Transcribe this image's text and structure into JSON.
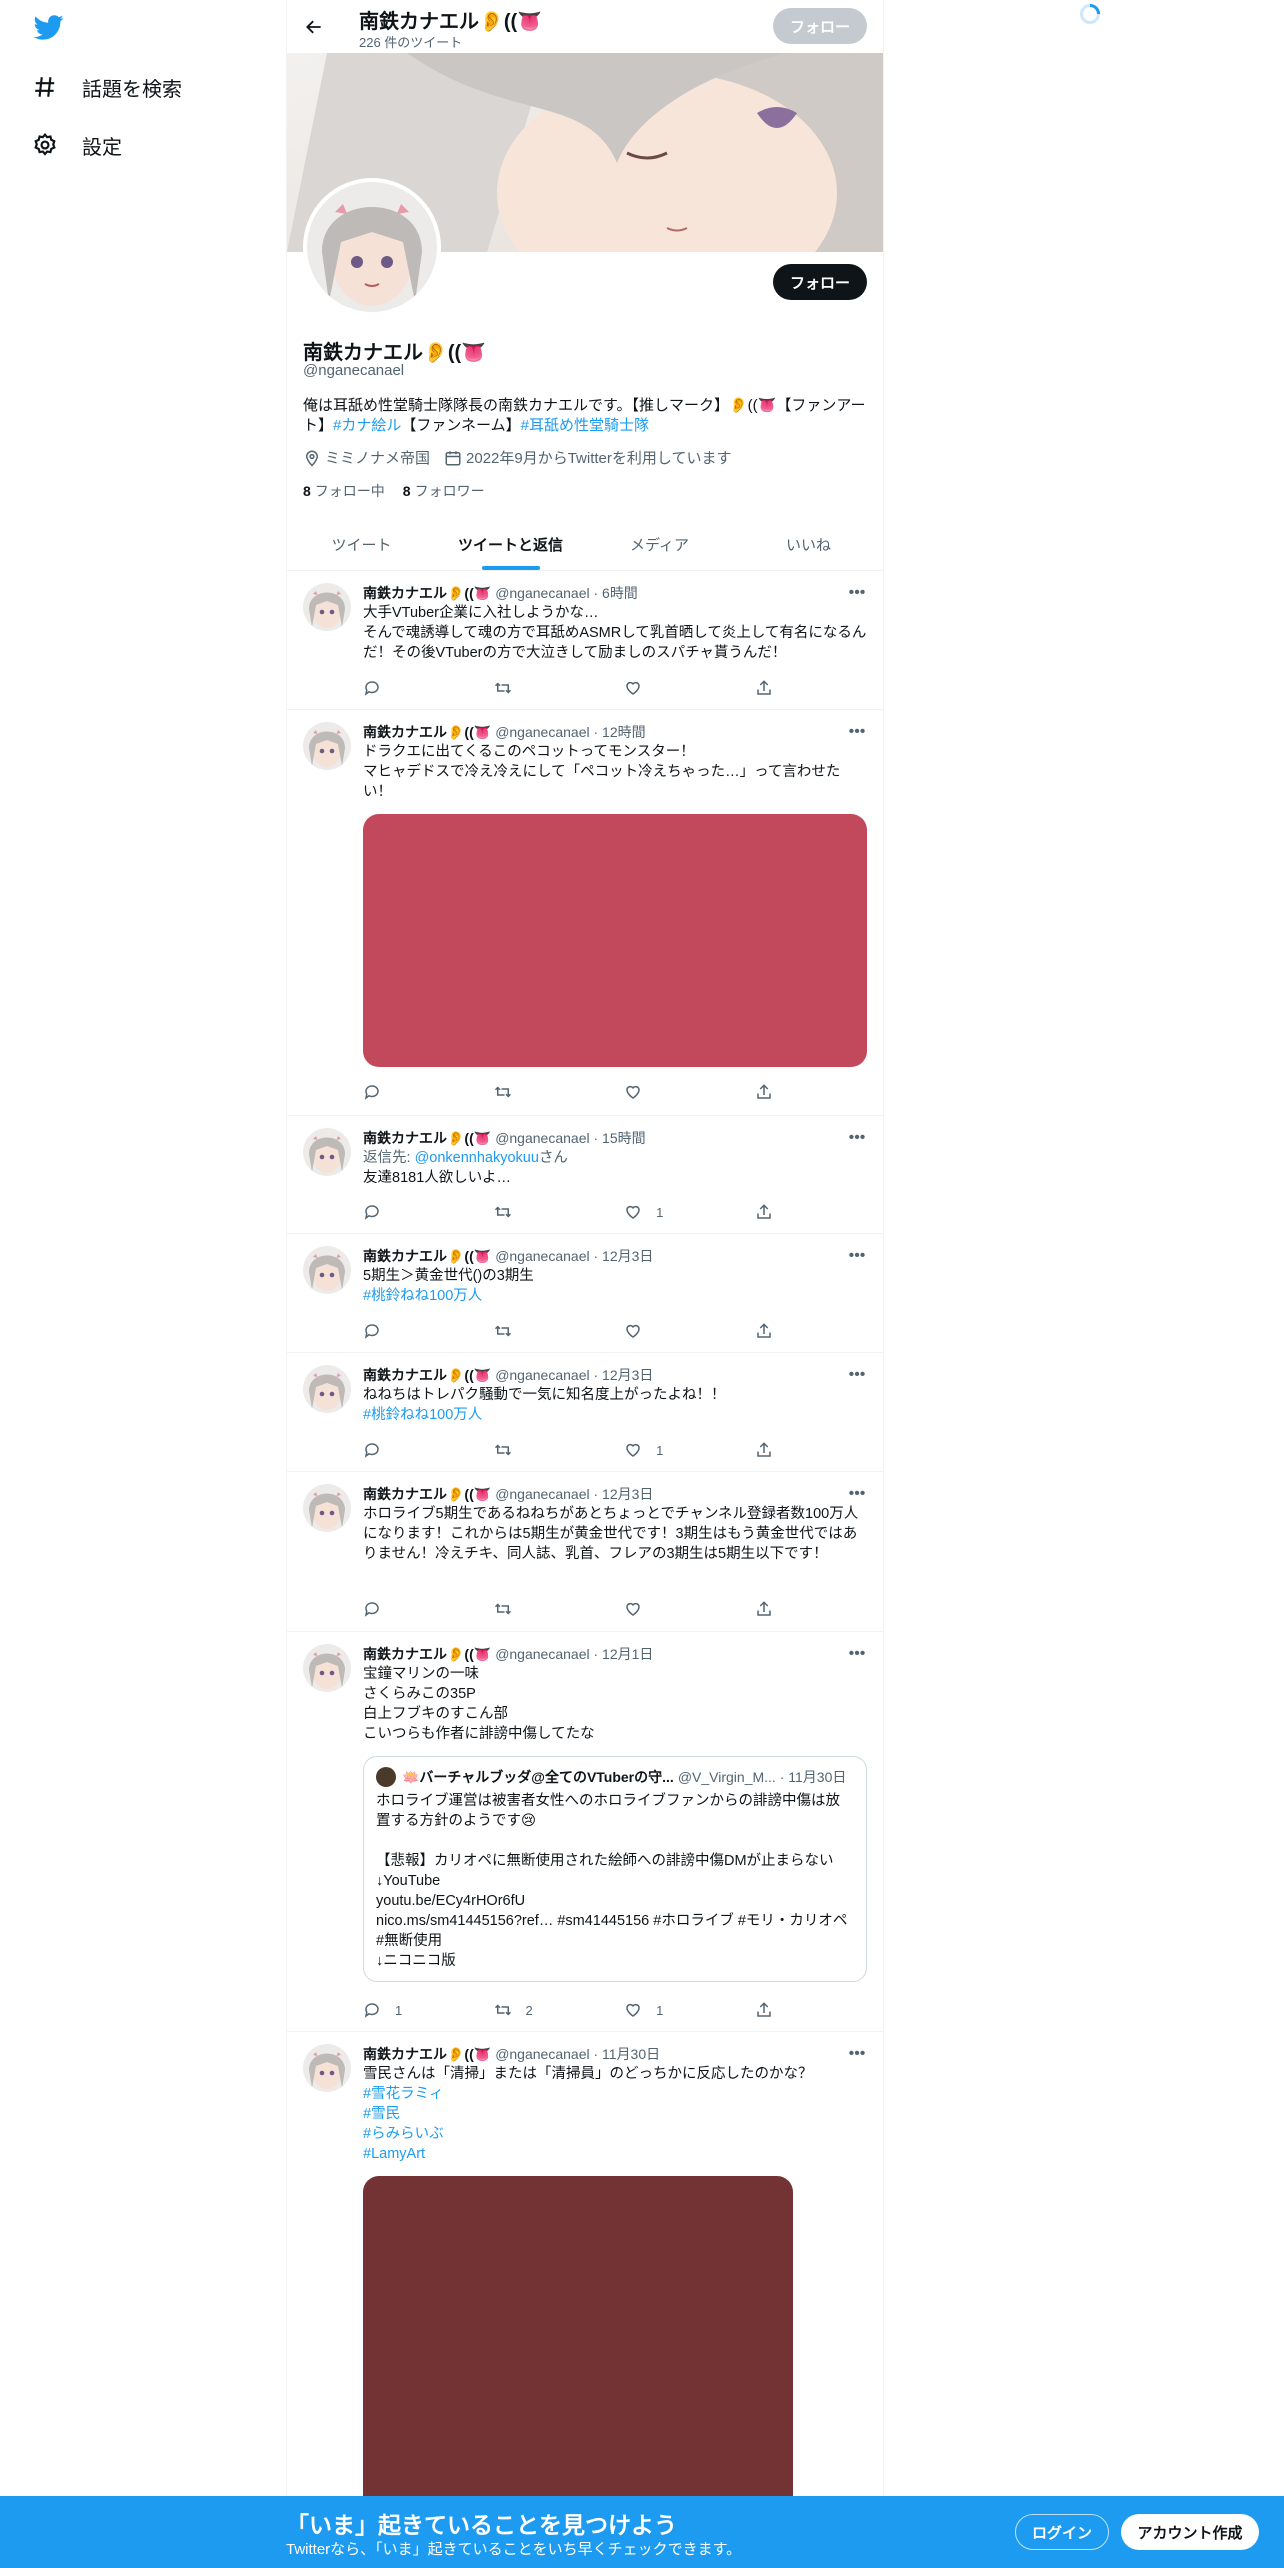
{
  "nav": {
    "items": [
      {
        "label": "話題を検索",
        "icon": "hashtag-icon"
      },
      {
        "label": "設定",
        "icon": "gear-icon"
      }
    ]
  },
  "topbar": {
    "name": "南鉄カナエル👂((👅",
    "tweet_count": "226 件のツイート",
    "follow": "フォロー"
  },
  "profile": {
    "name": "南鉄カナエル👂((👅",
    "handle": "@nganecanael",
    "follow": "フォロー",
    "bio_text1": "俺は耳舐め性堂騎士隊隊長の南鉄カナエルです。【推しマーク】👂((👅【ファンアート】",
    "bio_tag1": "#カナ絵ル",
    "bio_text2": "【ファンネーム】",
    "bio_tag2": "#耳舐め性堂騎士隊",
    "location": "ミミノナメ帝国",
    "joined": "2022年9月からTwitterを利用しています",
    "following_count": "8",
    "following_label": "フォロー中",
    "followers_count": "8",
    "followers_label": "フォロワー"
  },
  "tabs": [
    "ツイート",
    "ツイートと返信",
    "メディア",
    "いいね"
  ],
  "tweets": [
    {
      "name": "南鉄カナエル👂((👅",
      "meta": "@nganecanael · 6時間",
      "text": "大手VTuber企業に入社しようかな…\nそんで魂誘導して魂の方で耳舐めASMRして乳首晒して炎上して有名になるんだ！その後VTuberの方で大泣きして励ましのスパチャ貰うんだ！",
      "reply": "",
      "retweet": "",
      "like": ""
    },
    {
      "name": "南鉄カナエル👂((👅",
      "meta": "@nganecanael · 12時間",
      "text": "ドラクエに出てくるこのペコットってモンスター！\nマヒャデドスで冷え冷えにして「ペコット冷えちゃった…」って言わせたい！",
      "media_color": "#c2495b",
      "reply": "",
      "retweet": "",
      "like": ""
    },
    {
      "name": "南鉄カナエル👂((👅",
      "meta": "@nganecanael · 15時間",
      "reply_prefix": "返信先: ",
      "reply_to": "@onkennhakyokuu",
      "reply_suffix": "さん",
      "text": "友達8181人欲しいよ…",
      "reply": "",
      "retweet": "",
      "like": "1"
    },
    {
      "name": "南鉄カナエル👂((👅",
      "meta": "@nganecanael · 12月3日",
      "text": "5期生＞黄金世代()の3期生",
      "tag": "#桃鈴ねね100万人",
      "reply": "",
      "retweet": "",
      "like": ""
    },
    {
      "name": "南鉄カナエル👂((👅",
      "meta": "@nganecanael · 12月3日",
      "text": "ねねちはトレパク騒動で一気に知名度上がったよね！！",
      "tag": "#桃鈴ねね100万人",
      "reply": "",
      "retweet": "",
      "like": "1"
    },
    {
      "name": "南鉄カナエル👂((👅",
      "meta": "@nganecanael · 12月3日",
      "text": "ホロライブ5期生であるねねちがあとちょっとでチャンネル登録者数100万人になります！これからは5期生が黄金世代です！3期生はもう黄金世代ではありません！冷えチキ、同人誌、乳首、フレアの3期生は5期生以下です！",
      "reply": "",
      "retweet": "",
      "like": ""
    },
    {
      "name": "南鉄カナエル👂((👅",
      "meta": "@nganecanael · 12月1日",
      "text": "宝鐘マリンの一味\nさくらみこの35P\n白上フブキのすこん部\nこいつらも作者に誹謗中傷してたな",
      "quote": {
        "name": "🪷バーチャルブッダ@全てのVTuberの守...",
        "meta": "@V_Virgin_M... · 11月30日",
        "text": "ホロライブ運営は被害者女性へのホロライブファンからの誹謗中傷は放置する方針のようです😢\n\n【悲報】カリオペに無断使用された絵師への誹謗中傷DMが止まらない\n↓YouTube\nyoutu.be/ECy4rHOr6fU\n nico.ms/sm41445156?ref… #sm41445156  #ホロライブ #モリ・カリオペ #無断使用\n↓ニコニコ版"
      },
      "reply": "1",
      "retweet": "2",
      "like": "1"
    },
    {
      "name": "南鉄カナエル👂((👅",
      "meta": "@nganecanael · 11月30日",
      "text": "雪民さんは「清掃」または「清掃員」のどっちかに反応したのかな？",
      "tags": [
        "#雪花ラミィ",
        "#雪民",
        "#らみらいぶ",
        "#LamyArt"
      ],
      "media_color": "#733335"
    }
  ],
  "bottom": {
    "title": "「いま」起きていることを見つけよう",
    "subtitle": "Twitterなら、「いま」起きていることをいち早くチェックできます。",
    "login": "ログイン",
    "signup": "アカウント作成"
  },
  "colors": {
    "accent": "#1d9bf0",
    "text": "#0f1419",
    "muted": "#536471"
  }
}
